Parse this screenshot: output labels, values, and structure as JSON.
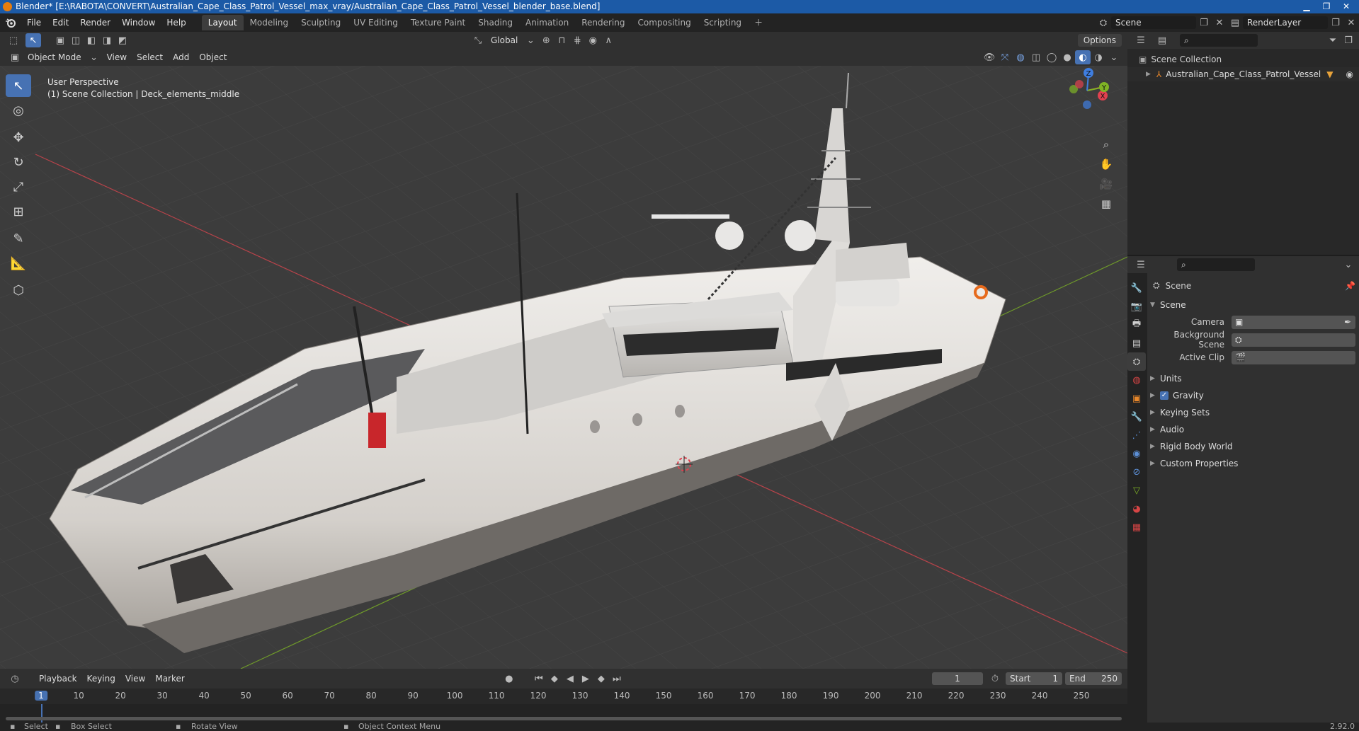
{
  "titlebar": {
    "title": "Blender* [E:\\RABOTA\\CONVERT\\Australian_Cape_Class_Patrol_Vessel_max_vray/Australian_Cape_Class_Patrol_Vessel_blender_base.blend]"
  },
  "menu": [
    "File",
    "Edit",
    "Render",
    "Window",
    "Help"
  ],
  "workspaces": [
    "Layout",
    "Modeling",
    "Sculpting",
    "UV Editing",
    "Texture Paint",
    "Shading",
    "Animation",
    "Rendering",
    "Compositing",
    "Scripting"
  ],
  "scene_name": "Scene",
  "view_layer": "RenderLayer",
  "viewport_header": {
    "orientation": "Global",
    "options": "Options",
    "mode": "Object Mode",
    "menus": [
      "View",
      "Select",
      "Add",
      "Object"
    ]
  },
  "viewport": {
    "perspective": "User Perspective",
    "collection_info": "(1) Scene Collection | Deck_elements_middle",
    "gizmo_axes": [
      "X",
      "Y",
      "Z"
    ]
  },
  "outliner": {
    "root": "Scene Collection",
    "items": [
      "Australian_Cape_Class_Patrol_Vessel"
    ]
  },
  "properties": {
    "context": "Scene",
    "section": "Scene",
    "fields": [
      {
        "label": "Camera",
        "value": ""
      },
      {
        "label": "Background Scene",
        "value": ""
      },
      {
        "label": "Active Clip",
        "value": ""
      }
    ],
    "panels": [
      "Units",
      "Gravity",
      "Keying Sets",
      "Audio",
      "Rigid Body World",
      "Custom Properties"
    ],
    "gravity_checked": true
  },
  "timeline": {
    "menus": [
      "Playback",
      "Keying",
      "View",
      "Marker"
    ],
    "current_frame": "1",
    "start_label": "Start",
    "start": "1",
    "end_label": "End",
    "end": "250",
    "ticks": [
      "1",
      "10",
      "20",
      "30",
      "40",
      "50",
      "60",
      "70",
      "80",
      "90",
      "100",
      "110",
      "120",
      "130",
      "140",
      "150",
      "160",
      "170",
      "180",
      "190",
      "200",
      "210",
      "220",
      "230",
      "240",
      "250"
    ]
  },
  "statusbar": {
    "items": [
      "Select",
      "Box Select",
      "Rotate View",
      "Object Context Menu"
    ],
    "version": "2.92.0"
  },
  "colors": {
    "accent": "#4772b3",
    "titlebar": "#1c5aa6",
    "axis_x": "#e0414f",
    "axis_y": "#7fb325",
    "axis_z": "#3f7ee0"
  }
}
